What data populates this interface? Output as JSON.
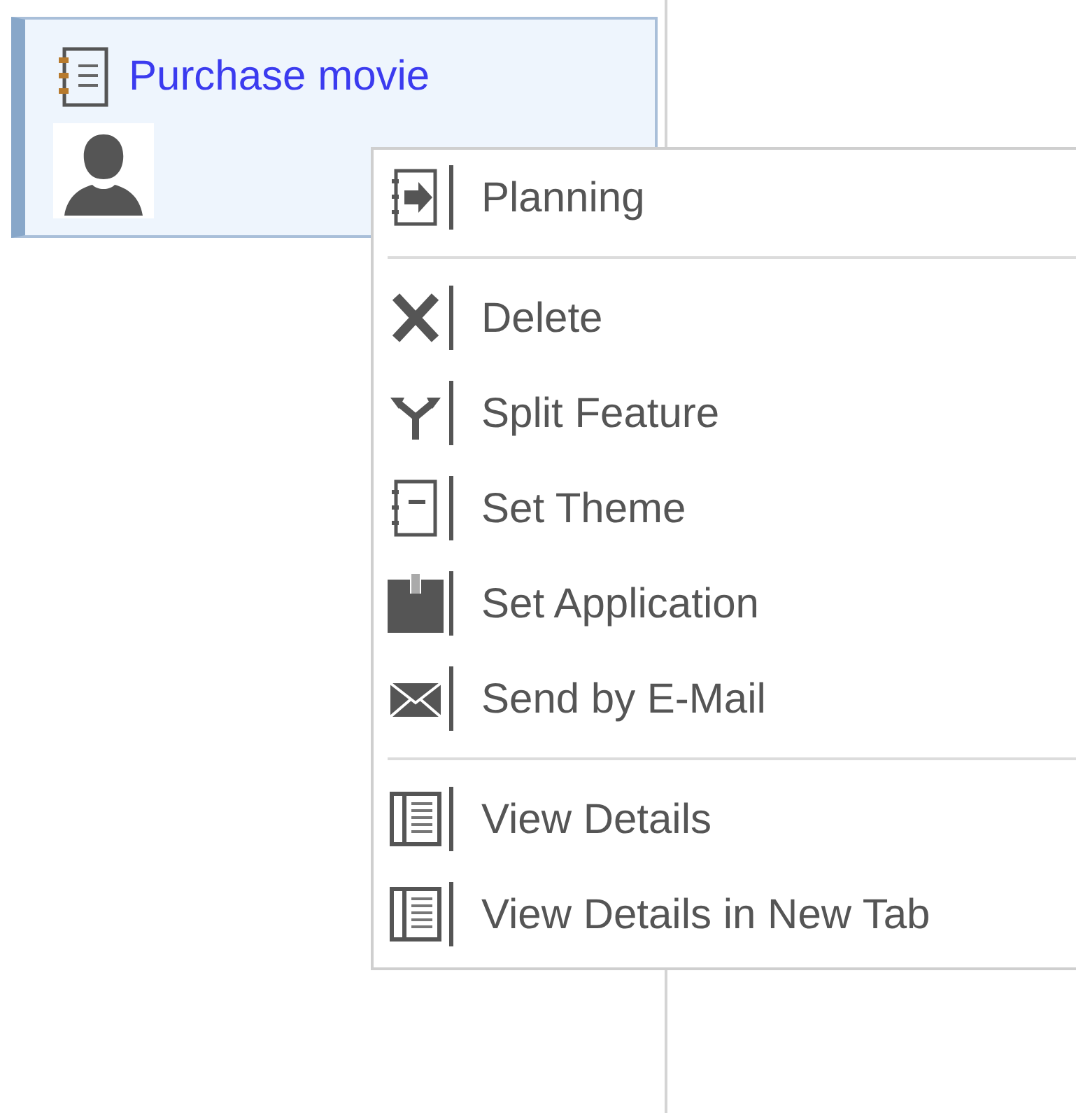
{
  "card": {
    "title": "Purchase movie"
  },
  "context_menu": {
    "groups": [
      [
        {
          "label": "Planning",
          "kind": "planning"
        }
      ],
      [
        {
          "label": "Delete",
          "kind": "delete"
        },
        {
          "label": "Split Feature",
          "kind": "split"
        },
        {
          "label": "Set Theme",
          "kind": "theme"
        },
        {
          "label": "Set Application",
          "kind": "application"
        },
        {
          "label": "Send by E-Mail",
          "kind": "email"
        }
      ],
      [
        {
          "label": "View Details",
          "kind": "details"
        },
        {
          "label": "View Details in New Tab",
          "kind": "details"
        }
      ]
    ]
  }
}
